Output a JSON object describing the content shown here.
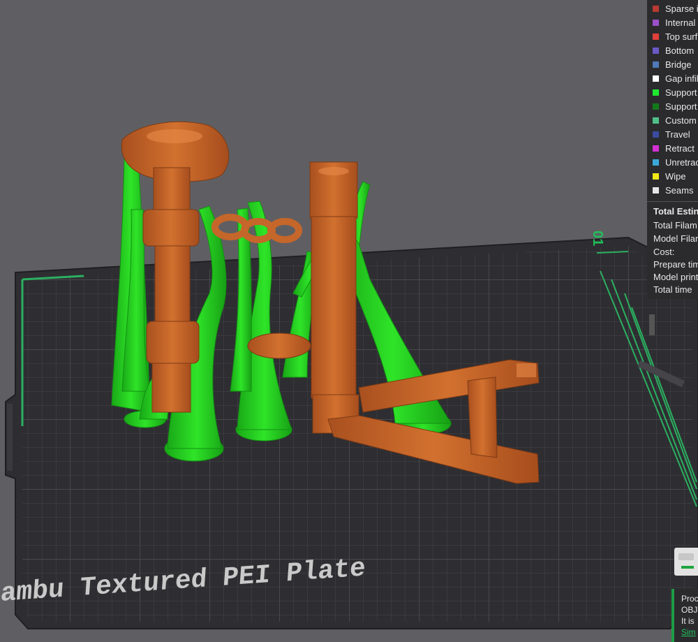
{
  "legend": {
    "items": [
      {
        "label": "Sparse i",
        "color": "#b83a32"
      },
      {
        "label": "Internal",
        "color": "#9b50c8"
      },
      {
        "label": "Top surf",
        "color": "#e0403a"
      },
      {
        "label": "Bottom",
        "color": "#6c58c6"
      },
      {
        "label": "Bridge",
        "color": "#5079b8"
      },
      {
        "label": "Gap infil",
        "color": "#ffffff"
      },
      {
        "label": "Support",
        "color": "#1ee830"
      },
      {
        "label": "Support",
        "color": "#137a1a"
      },
      {
        "label": "Custom",
        "color": "#4fbf8a"
      },
      {
        "label": "Travel",
        "color": "#3a4ca0"
      },
      {
        "label": "Retract",
        "color": "#d330d3"
      },
      {
        "label": "Unretrac",
        "color": "#3ba7d8"
      },
      {
        "label": "Wipe",
        "color": "#f0e818"
      },
      {
        "label": "Seams",
        "color": "#e6e6e6"
      }
    ]
  },
  "estimation": {
    "title": "Total Estin",
    "rows": [
      "Total Filam",
      "Model Filar",
      "Cost:",
      "Prepare tim",
      "Model print",
      "Total time"
    ]
  },
  "plate": {
    "label": "Bambu Textured PEI Plate",
    "number": "01"
  },
  "notification": {
    "line1": "Proc",
    "line2": "OBJ",
    "line3": "It is",
    "link": "Sim"
  },
  "colors": {
    "background": "#5f5f63",
    "bed": "#2f2f33",
    "model": "#c5662a",
    "support": "#22cc1e"
  }
}
